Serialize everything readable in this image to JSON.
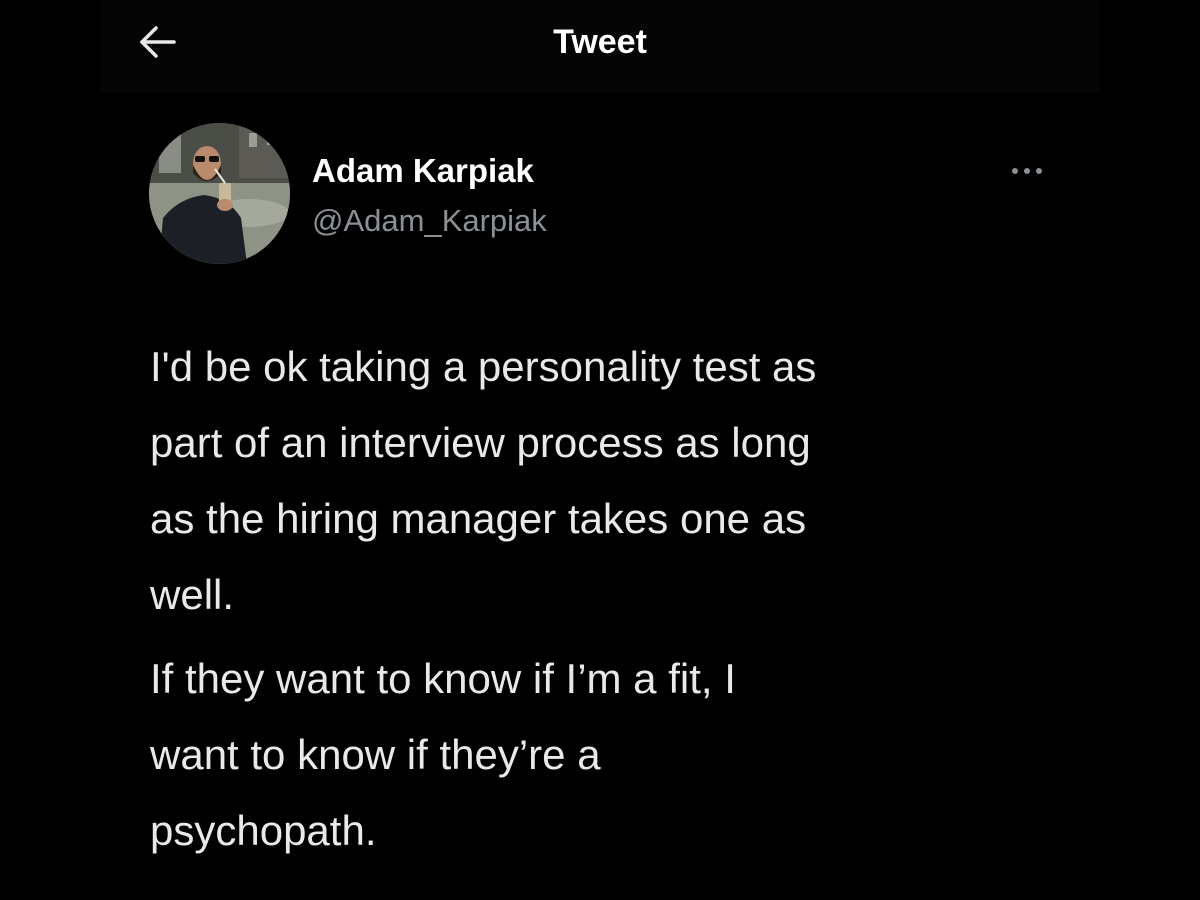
{
  "header": {
    "title": "Tweet",
    "back_icon": "arrow-left-icon"
  },
  "author": {
    "name": "Adam Karpiak",
    "handle": "@Adam_Karpiak",
    "avatar_icon": "user-avatar"
  },
  "more_icon": "more-horizontal-icon",
  "tweet": {
    "paragraphs": [
      "I'd be ok taking a personality test as\npart of an interview process as long\nas the hiring manager takes one as\nwell.",
      "If they want to know if I’m a fit, I\nwant to know if they’re a\npsychopath."
    ]
  },
  "colors": {
    "background": "#000000",
    "text_primary": "#e7e9ea",
    "text_secondary": "#8b9096"
  }
}
